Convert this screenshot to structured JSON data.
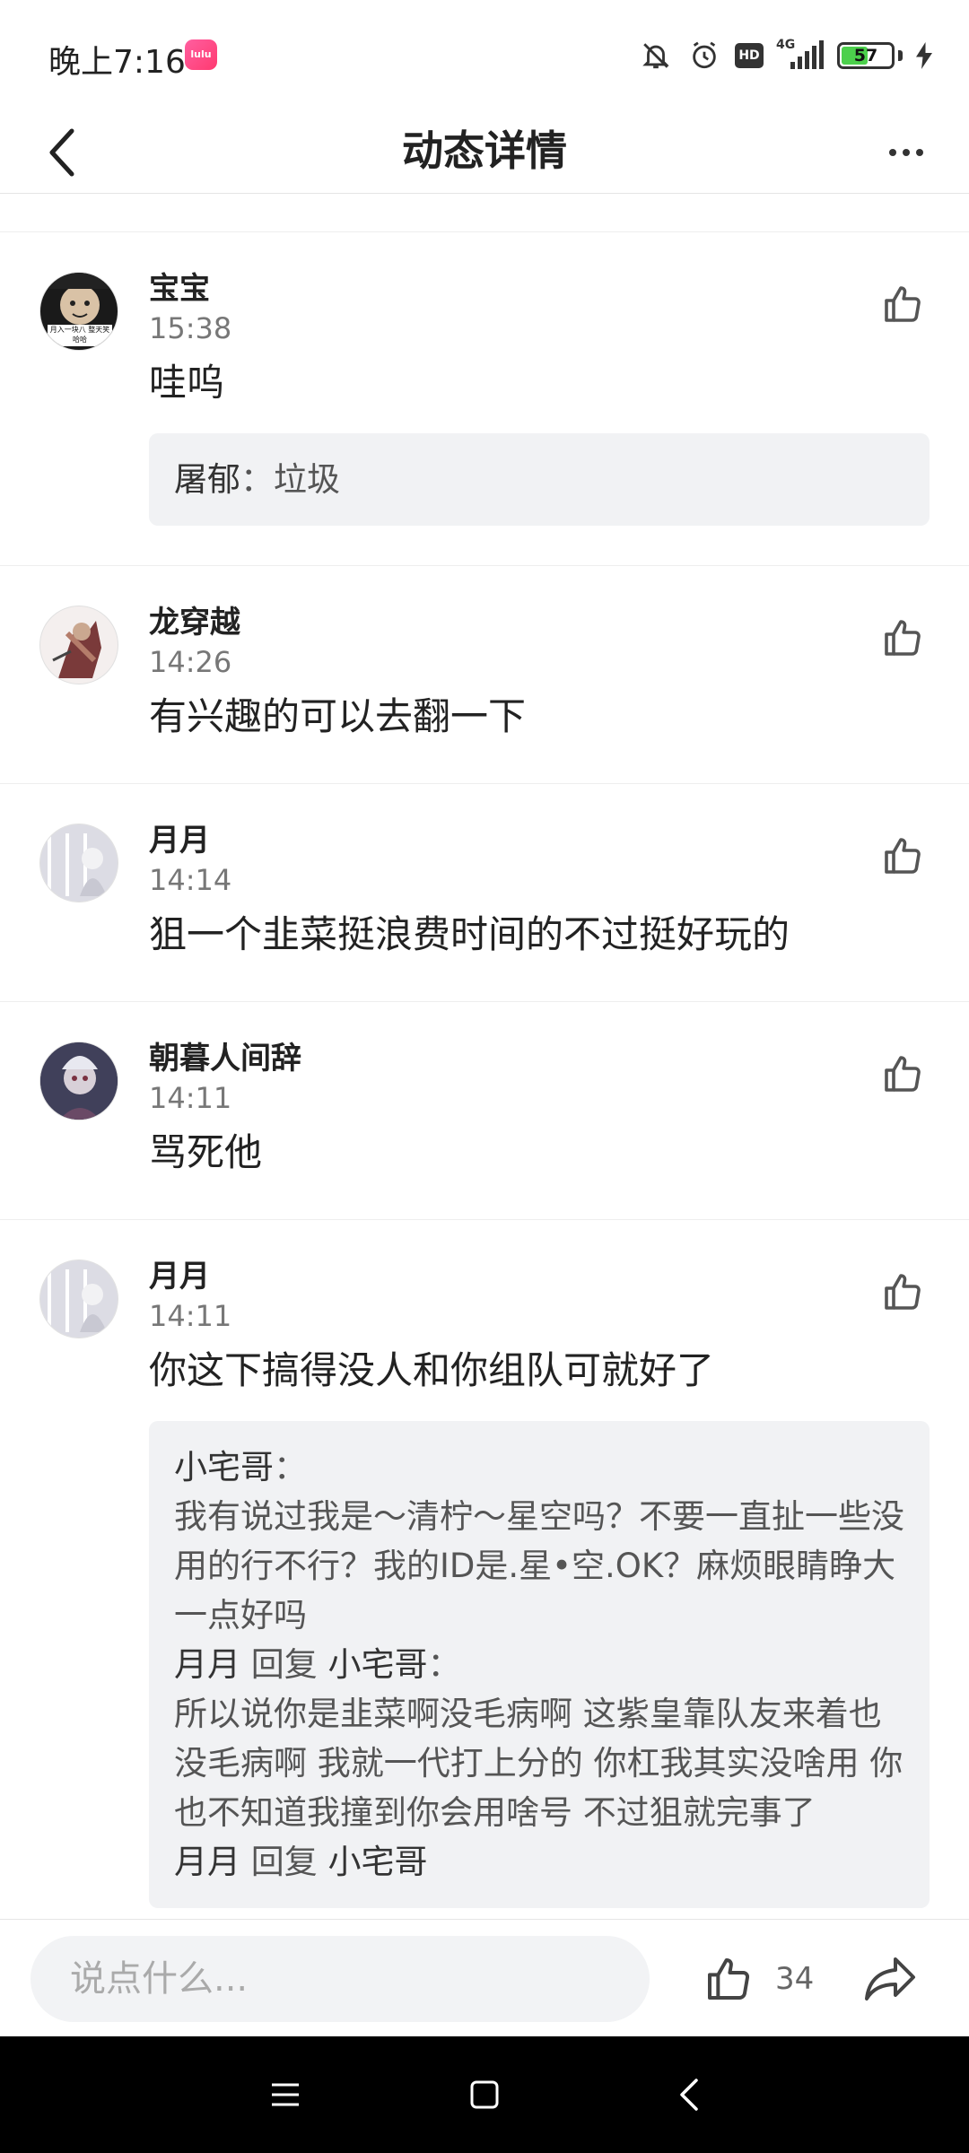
{
  "status_bar": {
    "time": "晚上7:16",
    "app_icon_text": "lulu",
    "network": "4G",
    "hd_label": "HD",
    "battery_level": "57",
    "battery_fraction": 0.57
  },
  "nav": {
    "title": "动态详情"
  },
  "comments": [
    {
      "name": "宝宝",
      "time": "15:38",
      "text": "哇呜",
      "avatar_caption": "月入一块八 整天笑哈哈",
      "replies": [
        {
          "author": "屠郁",
          "sep": "：",
          "body": "垃圾"
        }
      ]
    },
    {
      "name": "龙穿越",
      "time": "14:26",
      "text": "有兴趣的可以去翻一下"
    },
    {
      "name": "月月",
      "time": "14:14",
      "text": "狙一个韭菜挺浪费时间的不过挺好玩的"
    },
    {
      "name": "朝暮人间辞",
      "time": "14:11",
      "text": "骂死他"
    },
    {
      "name": "月月",
      "time": "14:11",
      "text": "你这下搞得没人和你组队可就好了",
      "replies": [
        {
          "author": "小宅哥",
          "sep": "：",
          "body": "我有说过我是～清柠～星空吗？不要一直扯一些没用的行不行？我的ID是.星•空.OK？麻烦眼睛睁大一点好吗"
        },
        {
          "author": "月月",
          "reply_word": "回复",
          "target": "小宅哥",
          "sep": "：",
          "body": "所以说你是韭菜啊没毛病啊 这紫皇靠队友来着也没毛病啊 我就一代打上分的 你杠我其实没啥用 你也不知道我撞到你会用啥号 不过狙就完事了"
        },
        {
          "author": "月月",
          "reply_word": "回复",
          "target": "小宅哥",
          "sep": "",
          "body": ""
        }
      ]
    }
  ],
  "bottom_bar": {
    "input_placeholder": "说点什么...",
    "like_count": "34"
  },
  "colors": {
    "reply_bg": "#f1f2f4",
    "divider": "#eeeeee",
    "system_nav": "#000000",
    "battery_fill": "#4cd04c"
  }
}
